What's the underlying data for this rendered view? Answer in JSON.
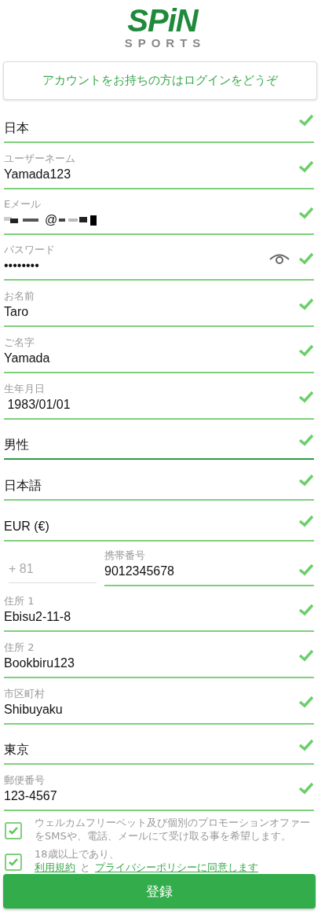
{
  "logo": {
    "title": "SPiN",
    "subtitle": "SPORTS"
  },
  "login_button": "アカウントをお持ちの方はログインをどうぞ",
  "fields": [
    {
      "kind": "select",
      "value": "日本",
      "valid": true
    },
    {
      "kind": "text",
      "label": "ユーザーネーム",
      "value": "Yamada123",
      "valid": true
    },
    {
      "kind": "masked",
      "label": "Eメール",
      "value": "@",
      "valid": true
    },
    {
      "kind": "password",
      "label": "パスワード",
      "value": "••••••••",
      "valid": true
    },
    {
      "kind": "text",
      "label": "お名前",
      "value": "Taro",
      "valid": true
    },
    {
      "kind": "text",
      "label": "ご名字",
      "value": "Yamada",
      "valid": true
    },
    {
      "kind": "text",
      "label": "生年月日",
      "value": " 1983/01/01",
      "valid": true
    },
    {
      "kind": "select",
      "value": "男性",
      "valid": true,
      "focused": true
    },
    {
      "kind": "select",
      "value": "日本語",
      "valid": true
    },
    {
      "kind": "select",
      "value": "EUR (€)",
      "valid": true
    },
    {
      "kind": "phone",
      "prefix": "+ 81",
      "label": "携帯番号",
      "value": "9012345678",
      "valid": true
    },
    {
      "kind": "text",
      "label": "住所 1",
      "value": "Ebisu2-11-8",
      "valid": true
    },
    {
      "kind": "text",
      "label": "住所 2",
      "value": "Bookbiru123",
      "valid": true
    },
    {
      "kind": "text",
      "label": "市区町村",
      "value": "Shibuyaku",
      "valid": true
    },
    {
      "kind": "select",
      "value": "東京",
      "valid": true
    },
    {
      "kind": "text",
      "label": "郵便番号",
      "value": "123-4567",
      "valid": true
    }
  ],
  "consents": [
    {
      "checked": true,
      "text": "ウェルカムフリーベット及び個別のプロモーションオファーをSMSや、電話、メールにて受け取る事を希望します。"
    },
    {
      "checked": true,
      "text": "18歳以上であり、",
      "links": [
        "利用規約",
        "プライバシーポリシーに同意します"
      ],
      "joiner": "と"
    }
  ],
  "submit_button": "登録"
}
